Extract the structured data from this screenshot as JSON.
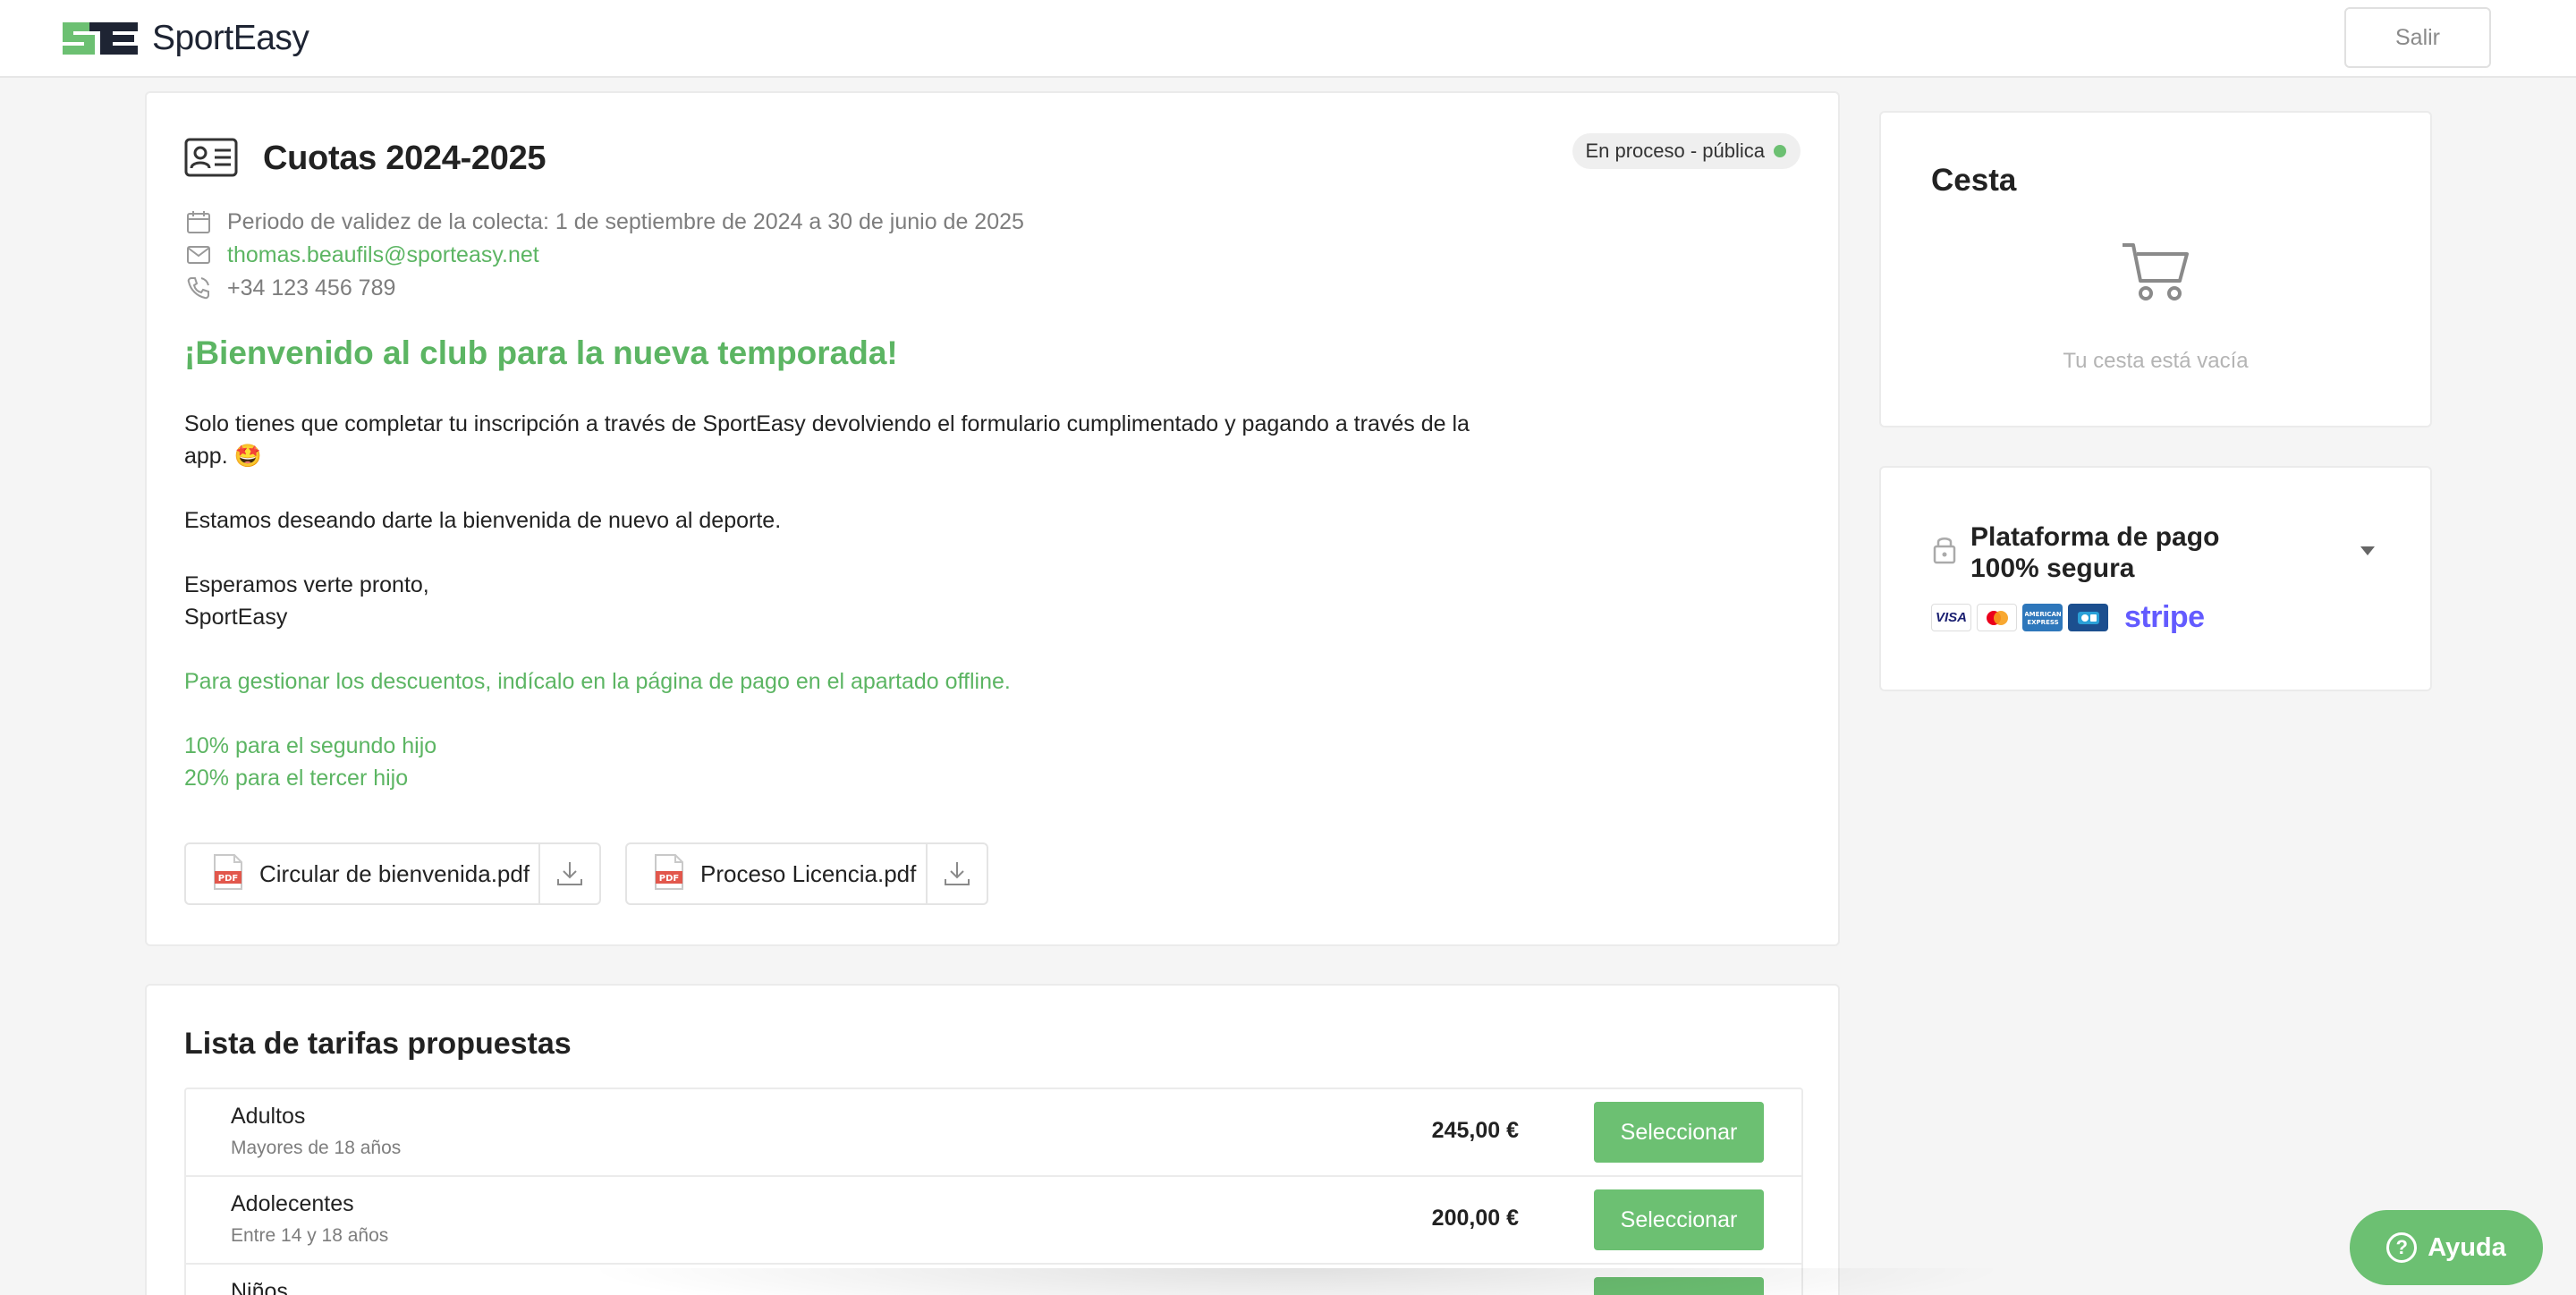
{
  "header": {
    "logo_text": "SportEasy",
    "exit_label": "Salir"
  },
  "collection": {
    "title": "Cuotas 2024-2025",
    "status": "En proceso - pública",
    "status_color": "#6cc072",
    "validity": "Periodo de validez de la colecta: 1 de septiembre de 2024 a 30 de junio de 2025",
    "email": "thomas.beaufils@sporteasy.net",
    "phone": "+34 123 456 789",
    "welcome": "¡Bienvenido al club para la nueva temporada!",
    "paragraph_1": "Solo tienes que completar tu inscripción a través de SportEasy devolviendo el formulario cumplimentado y pagando a través de la app. 🤩",
    "paragraph_2": "Estamos deseando darte la bienvenida de nuevo al deporte.",
    "paragraph_3": "Esperamos verte pronto,",
    "paragraph_4": "SportEasy",
    "discount_note": "Para gestionar los descuentos, indícalo en la página de pago en el apartado offline.",
    "discount_1": "10% para el segundo hijo",
    "discount_2": "20% para el tercer hijo",
    "attachments": [
      {
        "name": "Circular de bienvenida.pdf"
      },
      {
        "name": "Proceso Licencia.pdf"
      }
    ]
  },
  "tariffs": {
    "title": "Lista de tarifas propuestas",
    "select_label": "Seleccionar",
    "rows": [
      {
        "name": "Adultos",
        "description": "Mayores de 18 años",
        "price": "245,00 €"
      },
      {
        "name": "Adolecentes",
        "description": "Entre 14 y 18 años",
        "price": "200,00 €"
      },
      {
        "name": "Niños",
        "description": "",
        "price": ""
      }
    ]
  },
  "cart": {
    "title": "Cesta",
    "empty_text": "Tu cesta está vacía"
  },
  "secure": {
    "title": "Plataforma de pago 100% segura",
    "card_brands": [
      "VISA",
      "mastercard",
      "AMERICAN EXPRESS",
      "CB"
    ],
    "provider": "stripe"
  },
  "help": {
    "label": "Ayuda"
  },
  "colors": {
    "brand_green": "#6cc072",
    "link_green": "#5cb563",
    "logo_dark": "#1e2433",
    "stripe": "#635bff"
  }
}
